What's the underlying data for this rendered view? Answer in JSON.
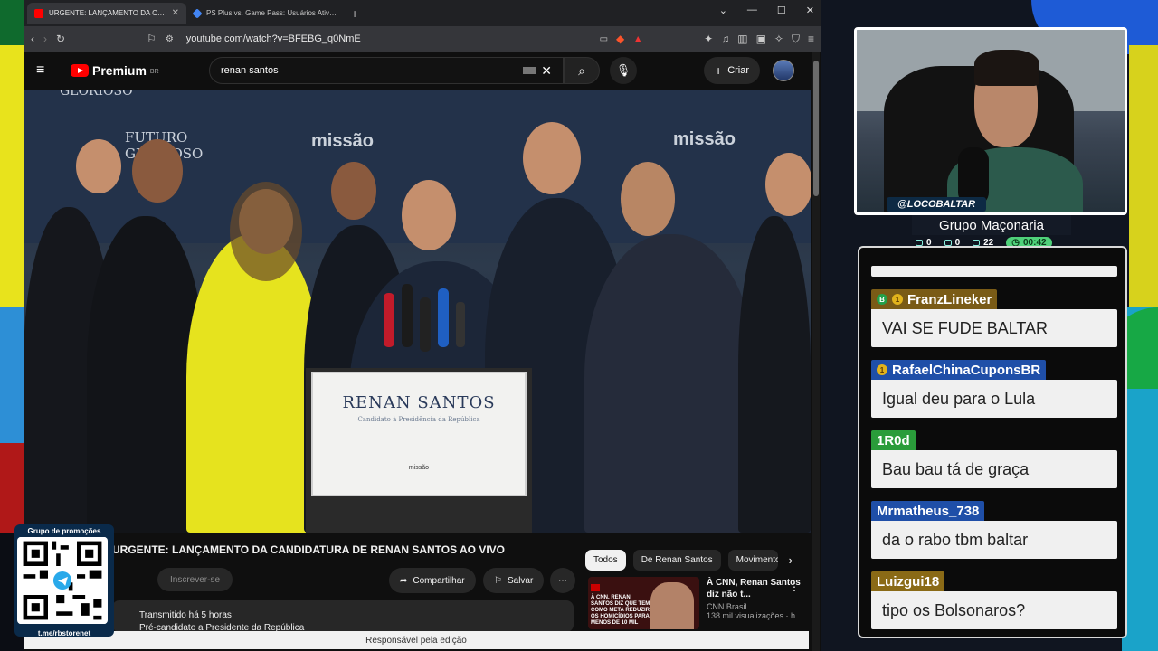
{
  "browser": {
    "tabs": [
      {
        "title": "URGENTE: LANÇAMENTO DA CANDIDATURA DE RENAN SANTOS AO VIVO",
        "favicon_color": "#ff0000",
        "active": true
      },
      {
        "title": "PS Plus vs. Game Pass: Usuários Ativos - Google",
        "favicon_color": "#4285f4",
        "active": false
      }
    ],
    "url": "youtube.com/watch?v=BFEBG_q0NmE"
  },
  "youtube": {
    "logo_text": "Premium",
    "logo_region": "BR",
    "search_value": "renan santos",
    "create_label": "Criar",
    "video_title": "URGENTE: LANÇAMENTO DA CANDIDATURA DE RENAN SANTOS AO VIVO",
    "subscribe_label": "Inscrever-se",
    "share_label": "Compartilhar",
    "save_label": "Salvar",
    "description_line1": "Transmitido há 5 horas",
    "description_line2": "Pré-candidato a Presidente da República",
    "chips": [
      "Todos",
      "De Renan Santos",
      "Movimento"
    ],
    "related": {
      "title": "À CNN, Renan Santos diz não t...",
      "channel": "CNN Brasil",
      "views": "138 mil visualizações · h...",
      "thumb_text": "À CNN, RENAN SANTOS DIZ QUE TEM COMO META REDUZIR OS HOMICÍDIOS PARA MENOS DE 10 MIL"
    },
    "status_bar": "Responsável pela edição",
    "video_scene": {
      "backdrop_words": [
        "GLORIOSO",
        "FUTURO GLORIOSO",
        "missão",
        "missão",
        "missão"
      ],
      "podium_name": "RENAN SANTOS",
      "podium_subtitle": "Candidato à Presidência da República",
      "podium_logo": "missão"
    }
  },
  "overlay": {
    "qr_header": "Grupo de promoções",
    "qr_footer": "t.me/rbstorenet"
  },
  "webcam": {
    "handle": "@LOCOBALTAR",
    "title": "Grupo Maçonaria",
    "stats": [
      {
        "icon": "chat-icon",
        "value": "0"
      },
      {
        "icon": "video-icon",
        "value": "0"
      },
      {
        "icon": "viewers-icon",
        "value": "22"
      },
      {
        "icon": "clock-icon",
        "value": "00:42"
      }
    ]
  },
  "chat": {
    "messages": [
      {
        "user": "FranzLineker",
        "text": "VAI SE FUDE BALTAR",
        "name_bg": "#7a5b16",
        "badges": [
          "green",
          "gold"
        ]
      },
      {
        "user": "RafaelChinaCuponsBR",
        "text": "Igual deu para o Lula",
        "name_bg": "#1f4fa8",
        "badges": [
          "gold"
        ]
      },
      {
        "user": "1R0d",
        "text": "Bau bau tá de graça",
        "name_bg": "#2a9c3a",
        "badges": []
      },
      {
        "user": "Mrmatheus_738",
        "text": "da o rabo tbm baltar",
        "name_bg": "#1f4fa8",
        "badges": []
      },
      {
        "user": "Luizgui18",
        "text": "tipo os Bolsonaros?",
        "name_bg": "#8a6a16",
        "badges": []
      }
    ]
  }
}
